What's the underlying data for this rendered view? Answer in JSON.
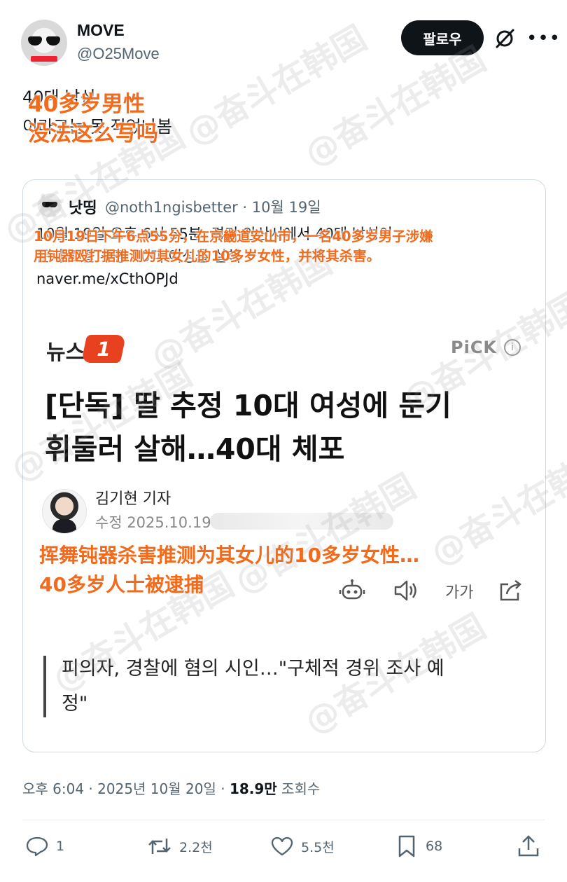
{
  "author": {
    "name": "MOVE",
    "handle": "@O25Move"
  },
  "header": {
    "follow_label": "팔로우",
    "grok_icon": "grok-icon",
    "more_icon": "more-icon"
  },
  "post": {
    "text_lines": [
      "40대 남성",
      "이라고는 못 적었나봄"
    ],
    "caption_lines": [
      "40多岁男性",
      "没法这么写吗"
    ]
  },
  "quote": {
    "name": "낫띵",
    "handle": "@noth1ngisbetter",
    "date": "10월 19일",
    "meta": "@noth1ngisbetter · 10월 19일",
    "text_lines": [
      "10월 19일 오후 6시 55분, 경기 안산시에서 40대 남성이",
      "둔기로 딸 추정 10대 여성을 살해"
    ],
    "caption_lines": [
      "10月19日下午6点55分，在京畿道安山市，一名40多岁男子涉嫌",
      "用钝器殴打据推测为其女儿的10多岁女性，并将其杀害。"
    ],
    "link": "naver.me/xCthOPJd"
  },
  "article": {
    "logo_text": "뉴스",
    "logo_mark": "1",
    "pick": "PiCK",
    "headline_lines": [
      "[단독] 딸 추정 10대 여성에 둔기",
      "휘둘러 살해…40대 체포"
    ],
    "reporter_name": "김기현 기자",
    "updated": "수정 2025.10.19",
    "caption_lines": [
      "挥舞钝器杀害推测为其女儿的10多岁女性…",
      "40多岁人士被逮捕"
    ],
    "font_label": "가가",
    "subhead_lines": [
      "피의자, 경찰에 혐의 시인…\"구체적 경위 조사 예",
      "정\""
    ]
  },
  "footer": {
    "time_date": "오후 6:04 · 2025년 10월 20일 · ",
    "views": "18.9만",
    "views_label": " 조회수"
  },
  "actions": {
    "replies": "1",
    "retweets": "2.2천",
    "likes": "5.5천",
    "bookmarks": "68"
  },
  "watermark": "@奋斗在韩国",
  "colors": {
    "caption": "#f26a1b",
    "text": "#0f1419",
    "muted": "#536471",
    "follow_bg": "#0f1419",
    "border": "#cfd9de",
    "logo_red": "#e8411f"
  }
}
